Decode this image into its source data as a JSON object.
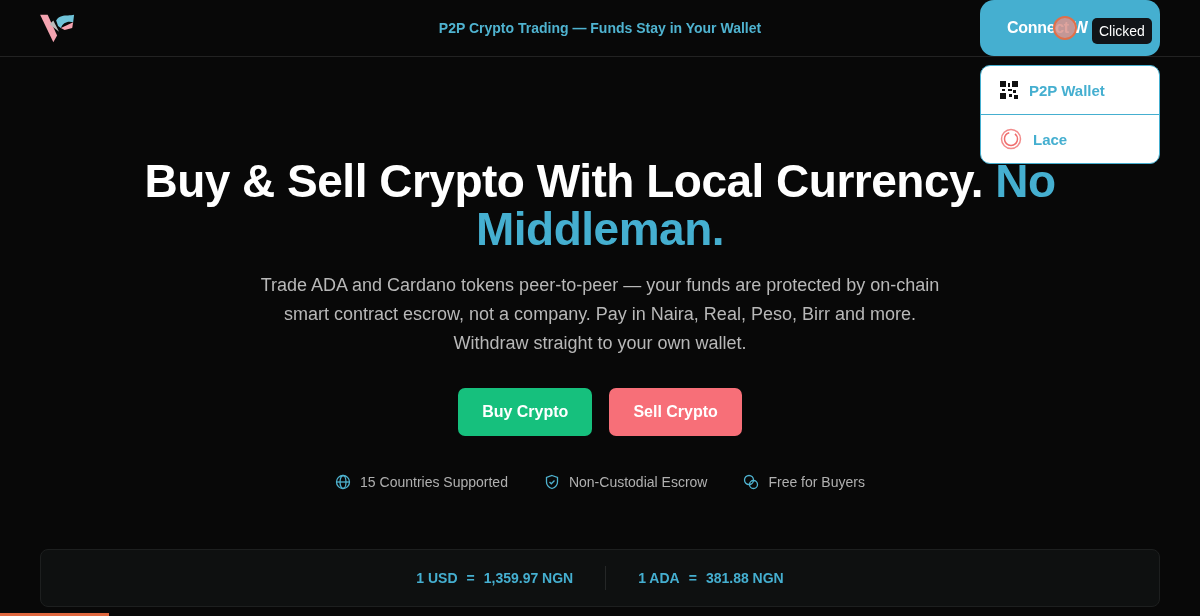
{
  "header": {
    "tagline": "P2P Crypto Trading — Funds Stay in Your Wallet",
    "connect_button": "Connect W",
    "tooltip": "Clicked"
  },
  "wallet_menu": [
    {
      "kind": "qr",
      "label": "P2P Wallet"
    },
    {
      "kind": "lace",
      "label": "Lace"
    }
  ],
  "hero": {
    "title": "Buy & Sell Crypto With Local Currency.",
    "title_accent": "No Middleman.",
    "description": "Trade ADA and Cardano tokens peer-to-peer — your funds are protected by on-chain smart contract escrow, not a company. Pay in Naira, Real, Peso, Birr and more. Withdraw straight to your own wallet.",
    "buttons": [
      {
        "kind": "buy",
        "label": "Buy Crypto"
      },
      {
        "kind": "sell",
        "label": "Sell Crypto"
      }
    ]
  },
  "features": [
    {
      "kind": "globe",
      "label": "15 Countries Supported"
    },
    {
      "kind": "shield",
      "label": "Non-Custodial Escrow"
    },
    {
      "kind": "coins",
      "label": "Free for Buyers"
    }
  ],
  "rates": [
    {
      "base": "1 USD",
      "eq": "=",
      "value": "1,359.97 NGN"
    },
    {
      "base": "1 ADA",
      "eq": "=",
      "value": "381.88 NGN"
    }
  ]
}
